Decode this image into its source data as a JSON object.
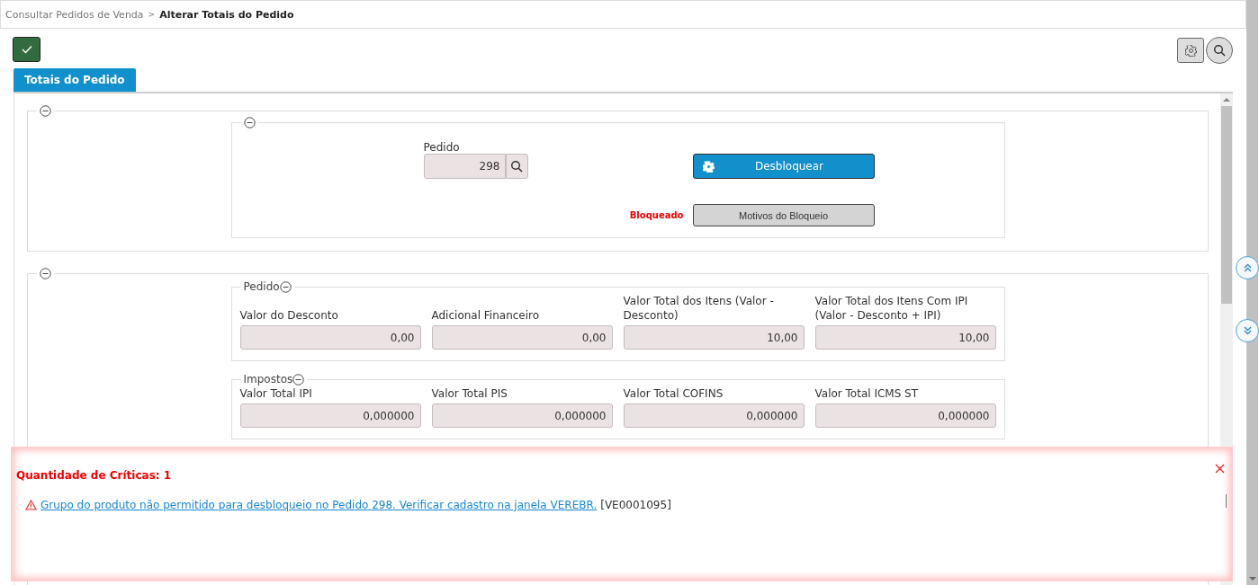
{
  "breadcrumb": [
    {
      "label": "Consultar Pedidos de Venda",
      "current": false
    },
    {
      "label": "Alterar Totais do Pedido",
      "current": true
    }
  ],
  "breadcrumb_separator": ">",
  "tabs": [
    {
      "label": "Totais do Pedido",
      "selected": true
    }
  ],
  "order": {
    "label": "Pedido",
    "value": "298",
    "status": "Bloqueado",
    "unlock_button": "Desbloquear",
    "reasons_button": "Motivos do Bloqueio"
  },
  "groups": [
    {
      "title": "Pedido",
      "fields": [
        {
          "label": "Valor do Desconto",
          "value": "0,00"
        },
        {
          "label": "Adicional Financeiro",
          "value": "0,00"
        },
        {
          "label": "Valor Total dos Itens (Valor - Desconto)",
          "value": "10,00"
        },
        {
          "label": "Valor Total dos Itens Com IPI (Valor - Desconto + IPI)",
          "value": "10,00"
        }
      ]
    },
    {
      "title": "Impostos",
      "fields": [
        {
          "label": "Valor Total IPI",
          "value": "0,000000"
        },
        {
          "label": "Valor Total PIS",
          "value": "0,000000"
        },
        {
          "label": "Valor Total COFINS",
          "value": "0,000000"
        },
        {
          "label": "Valor Total ICMS ST",
          "value": "0,000000"
        }
      ]
    }
  ],
  "alert": {
    "title": "Quantidade de Críticas: 1",
    "message": "Grupo do produto não permitido para desbloqueio no Pedido 298. Verificar cadastro na janela VEREBR.",
    "code": "[VE0001095]"
  }
}
